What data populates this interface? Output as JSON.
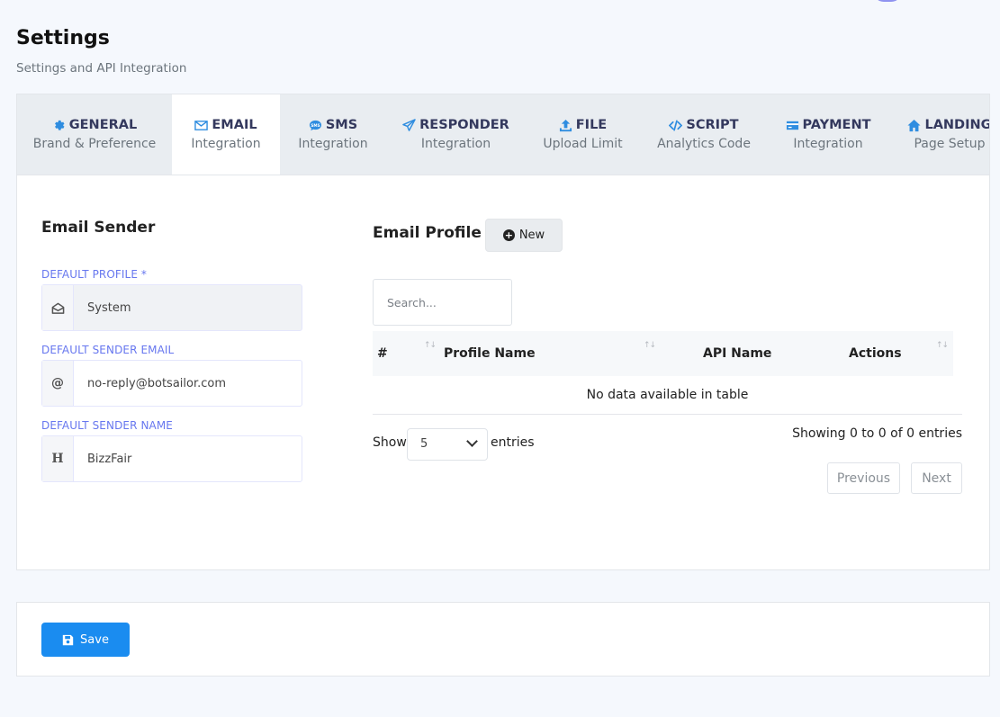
{
  "page": {
    "title": "Settings",
    "subtitle": "Settings and API Integration"
  },
  "tabs": [
    {
      "label": "GENERAL",
      "sub": "Brand & Preference",
      "icon": "gear-icon",
      "active": false
    },
    {
      "label": "EMAIL",
      "sub": "Integration",
      "icon": "envelope-icon",
      "active": true
    },
    {
      "label": "SMS",
      "sub": "Integration",
      "icon": "sms-bubble-icon",
      "active": false
    },
    {
      "label": "RESPONDER",
      "sub": "Integration",
      "icon": "paper-plane-icon",
      "active": false
    },
    {
      "label": "FILE",
      "sub": "Upload Limit",
      "icon": "upload-icon",
      "active": false
    },
    {
      "label": "SCRIPT",
      "sub": "Analytics Code",
      "icon": "code-icon",
      "active": false
    },
    {
      "label": "PAYMENT",
      "sub": "Integration",
      "icon": "credit-card-icon",
      "active": false
    },
    {
      "label": "LANDING",
      "sub": "Page Setup",
      "icon": "home-icon",
      "active": false
    }
  ],
  "sender": {
    "title": "Email Sender",
    "profile_label": "DEFAULT PROFILE *",
    "profile_value": "System",
    "email_label": "DEFAULT SENDER EMAIL",
    "email_value": "no-reply@botsailor.com",
    "email_icon": "@",
    "name_label": "DEFAULT SENDER NAME",
    "name_value": "BizzFair",
    "name_icon": "H"
  },
  "profile": {
    "title": "Email Profile",
    "new_label": "New",
    "search_placeholder": "Search...",
    "columns": [
      "#",
      "Profile Name",
      "API Name",
      "Actions"
    ],
    "empty_text": "No data available in table",
    "show_label": "Show",
    "entries_label": "entries",
    "page_length": "5",
    "info": "Showing 0 to 0 of 0 entries",
    "prev_label": "Previous",
    "next_label": "Next"
  },
  "footer": {
    "save_label": "Save"
  },
  "colors": {
    "accent": "#1a8cf0",
    "icon_blue": "#2f8de0",
    "label_purple": "#6777ef",
    "active_tab_border": "#3abaf4"
  }
}
